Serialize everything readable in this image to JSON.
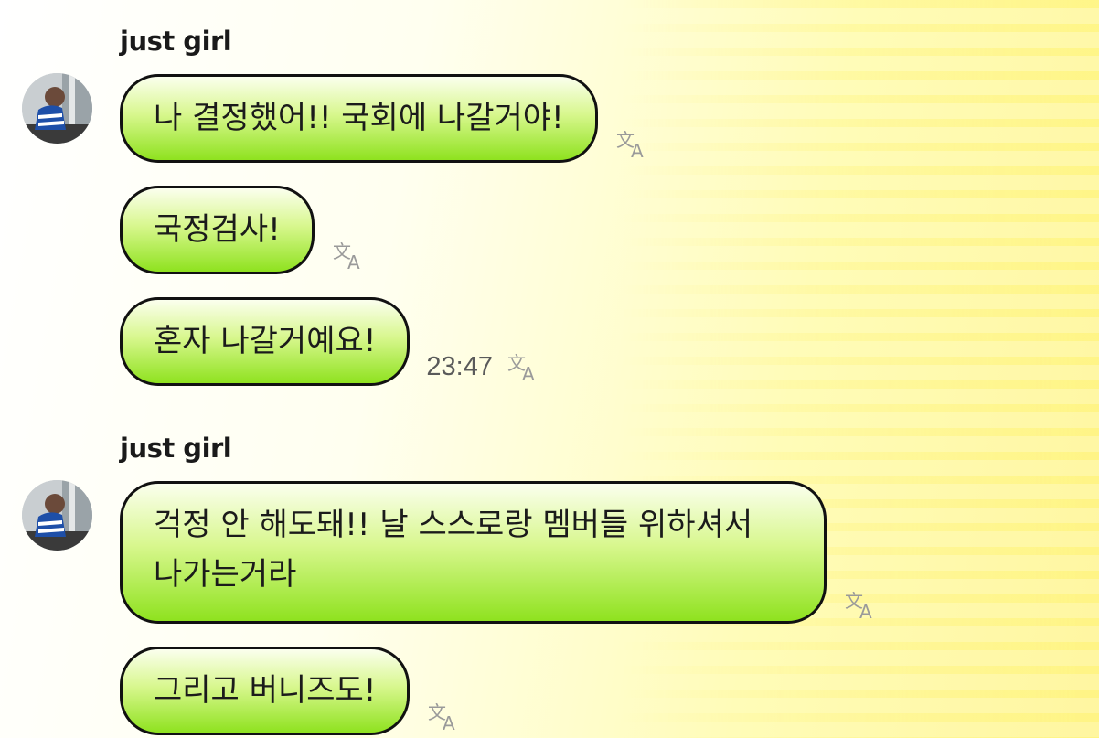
{
  "colors": {
    "bubble_top": "#fbffee",
    "bubble_bottom": "#8fe21f",
    "bubble_border": "#111111",
    "background": "#fffcb8"
  },
  "icons": {
    "translate": "translate-icon",
    "avatar": "avatar"
  },
  "groups": [
    {
      "sender": "just girl",
      "messages": [
        {
          "text": "나 결정했어!! 국회에 나갈거야!",
          "time": ""
        },
        {
          "text": "국정검사!",
          "time": ""
        },
        {
          "text": "혼자 나갈거예요!",
          "time": "23:47"
        }
      ]
    },
    {
      "sender": "just girl",
      "messages": [
        {
          "text": "걱정 안 해도돼!! 날 스스로랑 멤버들 위하셔서\n나가는거라",
          "time": ""
        },
        {
          "text": "그리고 버니즈도!",
          "time": ""
        }
      ]
    }
  ]
}
